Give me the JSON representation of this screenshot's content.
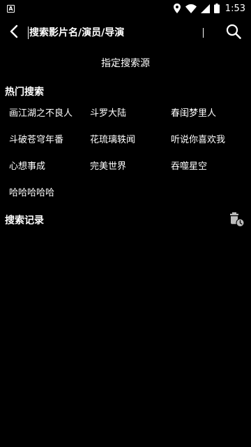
{
  "status_bar": {
    "notification_icon_letter": "A",
    "time": "1:53",
    "icons": [
      "location-icon",
      "wifi-icon",
      "signal-icon",
      "battery-icon"
    ]
  },
  "toolbar": {
    "back_icon": "chevron-left-icon",
    "search_placeholder": "搜索影片名/演员/导演",
    "search_icon": "search-icon"
  },
  "source_button": "指定搜索源",
  "hot_search": {
    "title": "热门搜索",
    "items": [
      "画江湖之不良人",
      "斗罗大陆",
      "春闺梦里人",
      "斗破苍穹年番",
      "花琉璃轶闻",
      "听说你喜欢我",
      "心想事成",
      "完美世界",
      "吞噬星空",
      "哈哈哈哈哈"
    ]
  },
  "history": {
    "title": "搜索记录",
    "clear_icon": "trash-clock-icon"
  },
  "colors": {
    "background": "#000000",
    "text": "#ffffff",
    "icon_gray": "#bdbdbd"
  }
}
